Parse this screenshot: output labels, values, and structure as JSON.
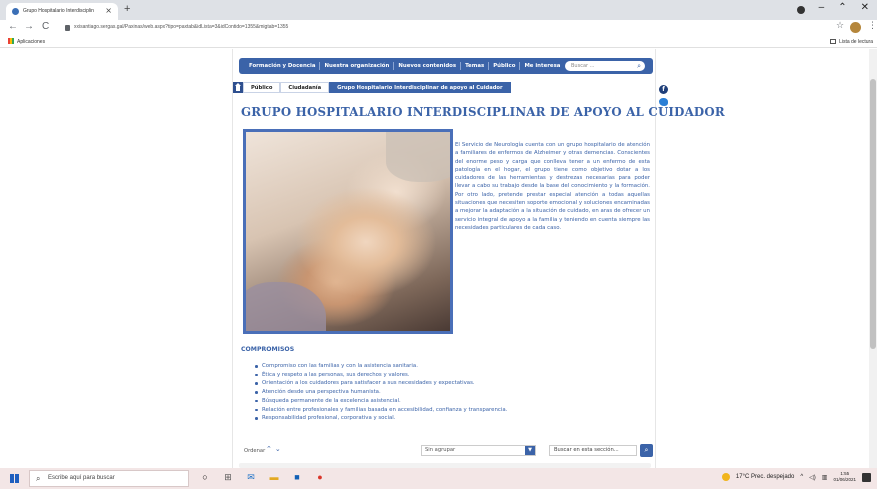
{
  "browser": {
    "tab_title": "Grupo Hospitalario Interdisciplin",
    "tab_close": "×",
    "new_tab": "+",
    "url": "xxisantiago.sergas.gal/Paxinas/web.aspx?tipo=paxtab&idLista=3&idContido=1355&migtab=1355",
    "bookmarks_apps": "Aplicaciones",
    "reading_list": "Lista de lectura",
    "controls": {
      "minimize": "–",
      "maximize": "⌃",
      "close": "✕"
    }
  },
  "site": {
    "nav": [
      "Formación y Docencia",
      "Nuestra organización",
      "Nuevos contenidos",
      "Temas",
      "Público",
      "Me interesa"
    ],
    "search_placeholder": "Buscar ...",
    "breadcrumb": [
      "Público",
      "Ciudadanía",
      "Grupo Hospitalario Interdisciplinar de apoyo al Cuidador"
    ],
    "page_title": "GRUPO HOSPITALARIO INTERDISCIPLINAR DE APOYO AL CUIDADOR",
    "description": "El Servicio de Neurología cuenta con un grupo hospitalario de atención a familiares de enfermos de Alzheimer y otras demencias. Conscientes del enorme peso y carga que conlleva tener a un enfermo de esta patología en el hogar, el grupo tiene como objetivo dotar a los cuidadores de las herramientas y destrezas necesarias para poder llevar a cabo su trabajo desde la base del conocimiento y la formación. Por otro lado, pretende prestar especial atención a todas aquellas situaciones que necesiten soporte emocional y soluciones encaminadas a mejorar la adaptación a la situación de cuidado, en aras de ofrecer un servicio integral de apoyo a la familia y teniendo en cuenta siempre las necesidades particulares de cada caso.",
    "compromisos_title": "COMPROMISOS",
    "compromisos": [
      "Compromiso con las familias y con la asistencia sanitaria.",
      "Ética y respeto a las personas, sus derechos y valores.",
      "Orientación a los cuidadores para satisfacer a sus necesidades y expectativas.",
      "Atención desde una perspectiva humanista.",
      "Búsqueda permanente de la excelencia asistencial.",
      "Relación entre profesionales y familias basada en accesibilidad, confianza y transparencia.",
      "Responsabilidad profesional, corporativa y social."
    ],
    "order_label": "Ordenar",
    "group_select": "Sin agrupar",
    "section_search": "Buscar en esta sección..."
  },
  "taskbar": {
    "search_placeholder": "Escribe aquí para buscar",
    "weather": "17°C Prec. despejado",
    "time": "1:55",
    "date": "01/06/2021"
  }
}
